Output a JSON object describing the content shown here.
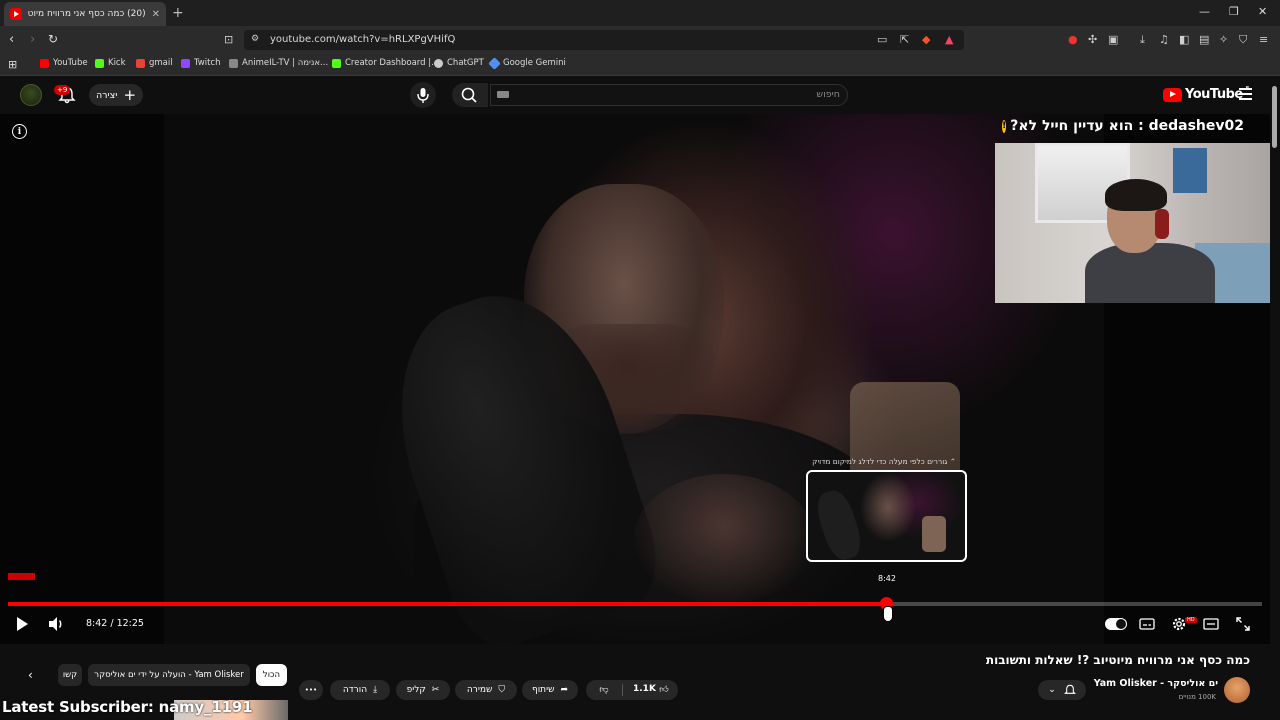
{
  "browser": {
    "tab_title": "(20) כמה כסף אני מרוויח מיוטיוב",
    "tab_close": "✕",
    "new_tab": "+",
    "url": "youtube.com/watch?v=hRLXPgVHifQ",
    "window_controls": [
      "—",
      "❐",
      "✕"
    ],
    "bookmarks": [
      {
        "label": "YouTube",
        "color": "#ff0000"
      },
      {
        "label": "Kick",
        "color": "#53fc18"
      },
      {
        "label": "gmail",
        "color": "#ea4335"
      },
      {
        "label": "Twitch",
        "color": "#9146ff"
      },
      {
        "label": "AnimeIL-TV | אנימה...",
        "color": "#888888"
      },
      {
        "label": "Creator Dashboard |...",
        "color": "#53fc18"
      },
      {
        "label": "ChatGPT",
        "color": "#cccccc"
      },
      {
        "label": "Google Gemini",
        "color": "#4f8ef7"
      }
    ]
  },
  "header": {
    "search_placeholder": "חיפוש",
    "create_label": "יצירה",
    "notifications_badge": "+9",
    "logo_text": "YouTube",
    "logo_sup": "IL"
  },
  "video": {
    "cam_caption": "?הוא עדיין חייל לא : dedashev02",
    "cam_coin": "!",
    "preview_hint": "גוררים כלפי מעלה כדי לדלג למיקום מדויק",
    "preview_time": "8:42",
    "current_time": "8:42",
    "duration": "12:25",
    "time_display": "8:42 / 12:25",
    "progress_fraction": 0.7
  },
  "below": {
    "title": "כמה כסף אני מרוויח מיוטיוב ?! שאלות ותשובות",
    "channel_name": "ים אוליסקר - Yam Olisker",
    "channel_subs": "100K מנויים",
    "like_count": "1.1K",
    "share_label": "שיתוף",
    "save_label": "שמירה",
    "clip_label": "קליפ",
    "download_label": "הורדה",
    "more_label": "•••",
    "chip_all": "הכול",
    "chip_uploader": "הועלה על ידי ים אוליסקר - Yam Olisker",
    "chip_related": "קשו"
  },
  "stream_overlay": {
    "latest_subscriber": "Latest Subscriber: namy_1191"
  },
  "colors": {
    "accent": "#ff0000",
    "background": "#0f0f0f",
    "pill": "#272727"
  }
}
